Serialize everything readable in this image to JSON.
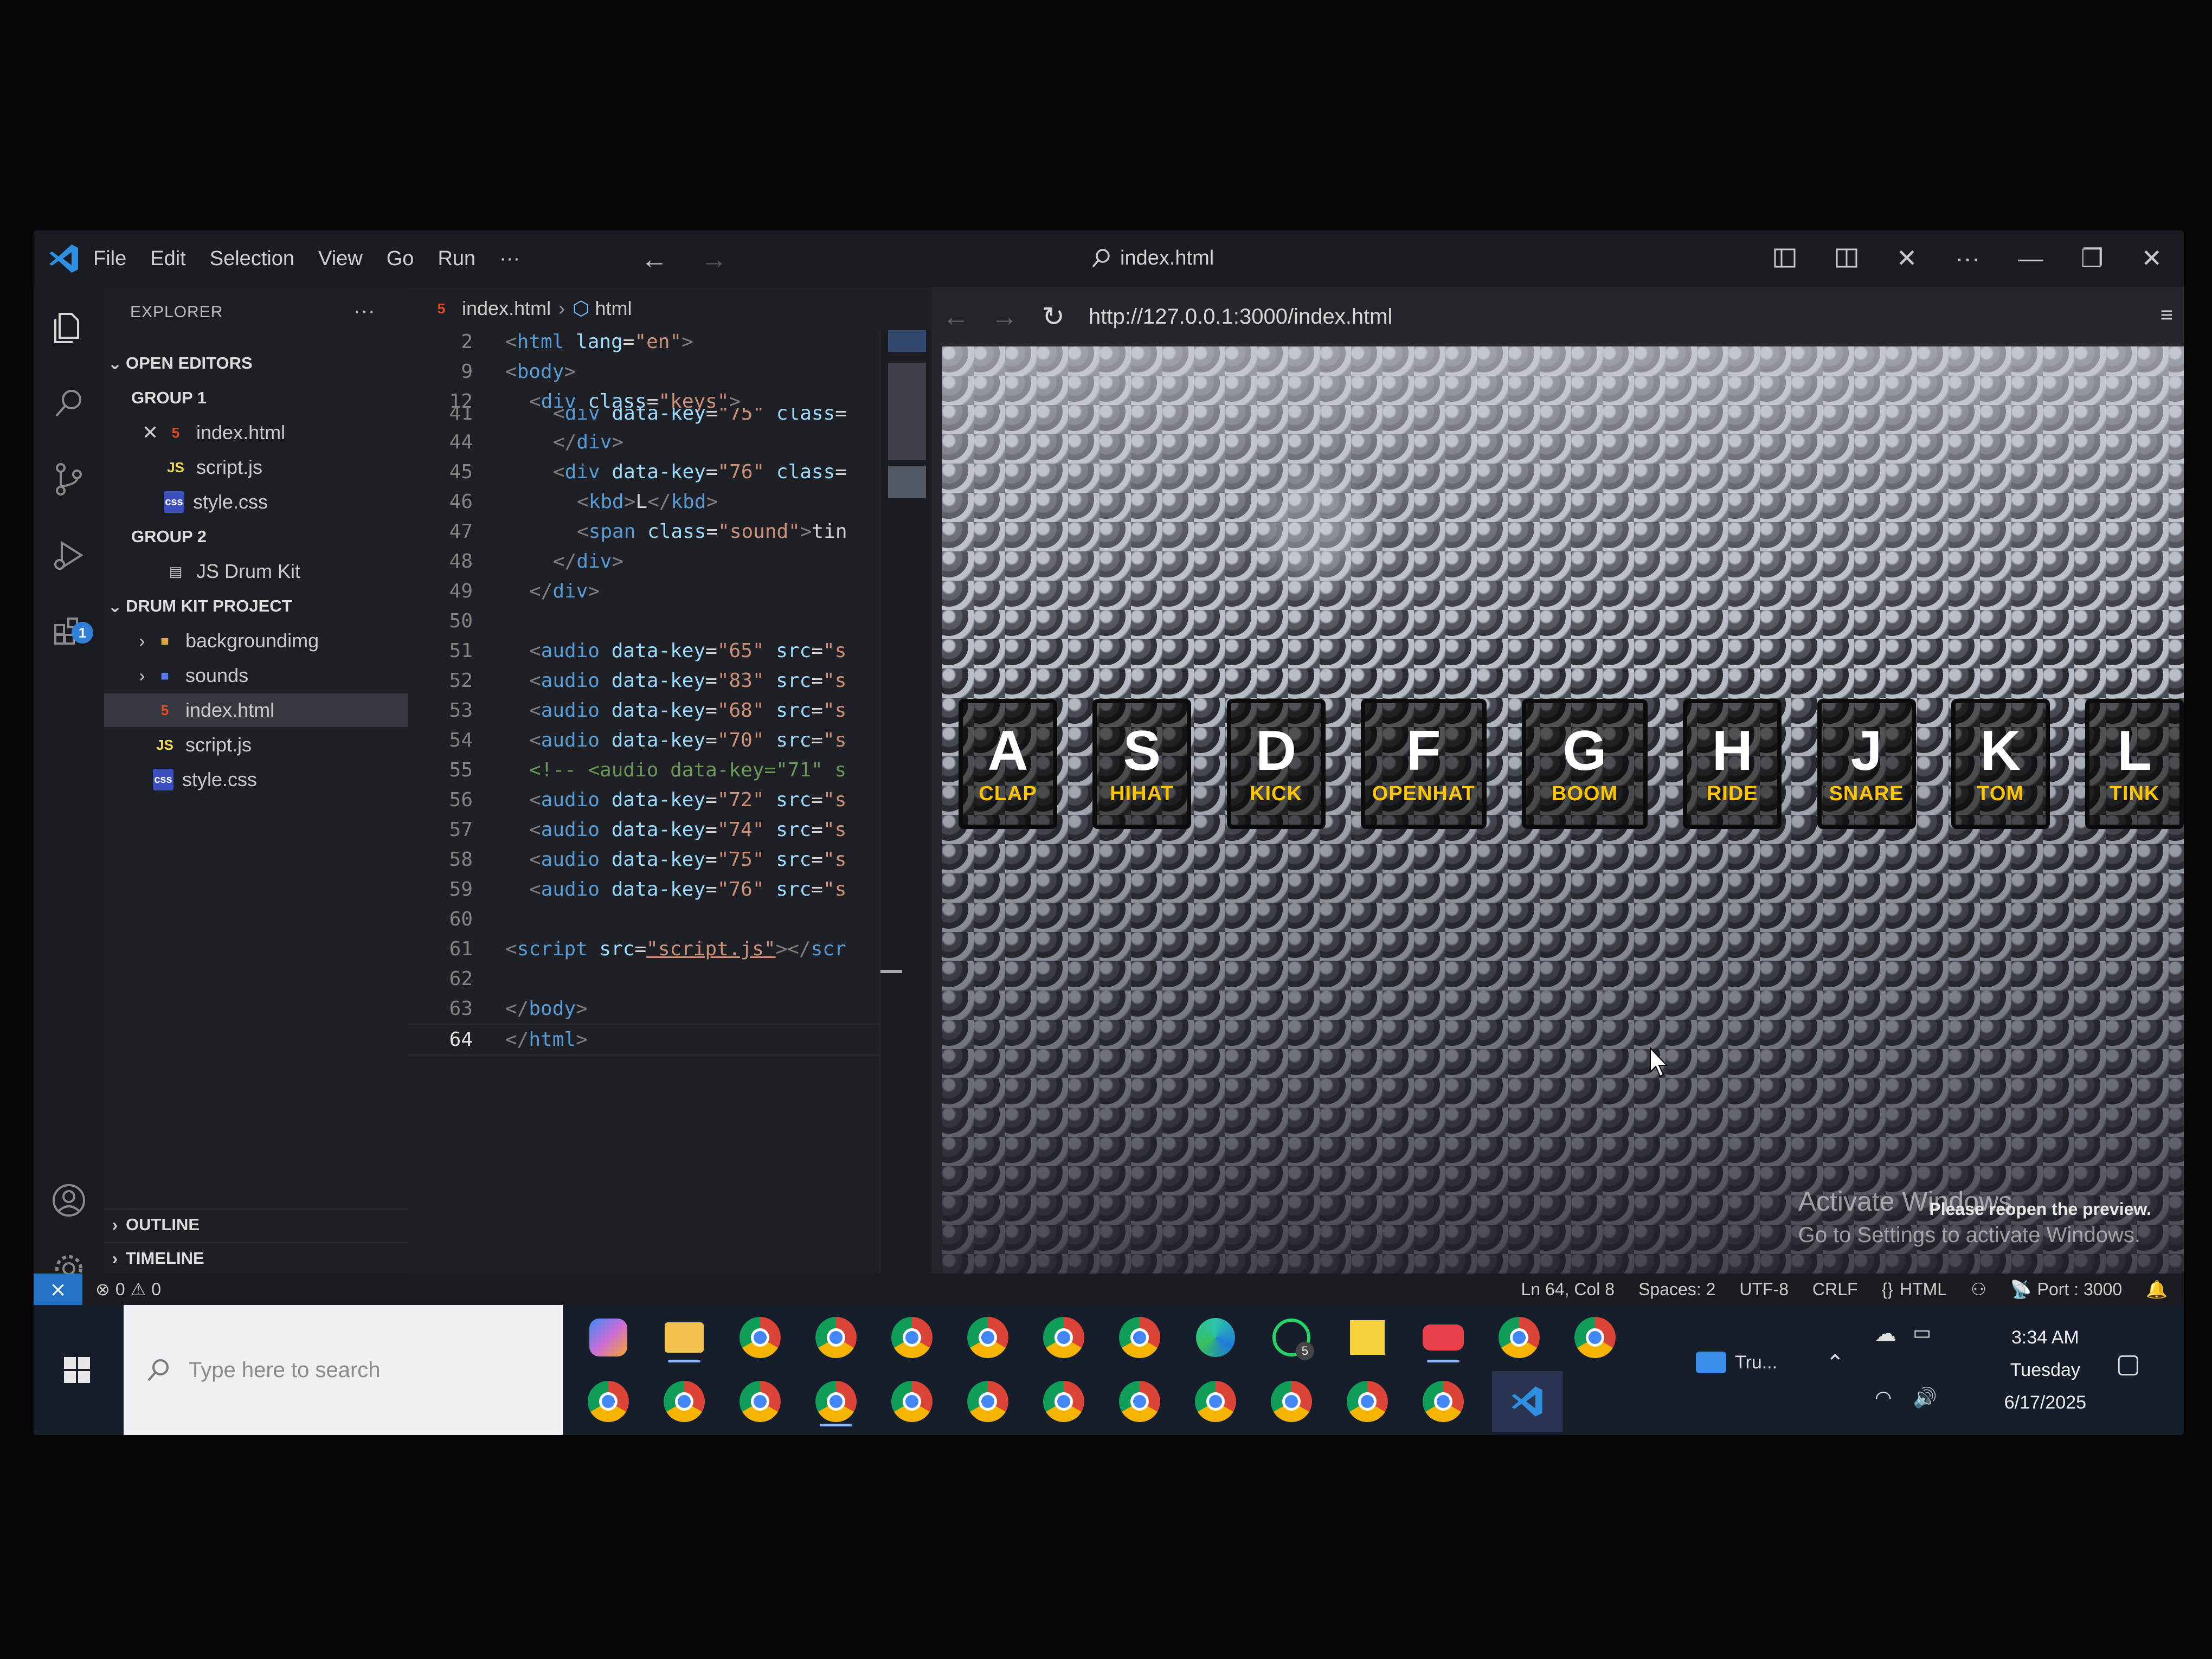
{
  "window": {
    "menu": [
      "File",
      "Edit",
      "Selection",
      "View",
      "Go",
      "Run",
      "···"
    ],
    "search_title": "index.html"
  },
  "sidebar": {
    "title": "EXPLORER",
    "open_editors_label": "OPEN EDITORS",
    "group1_label": "GROUP 1",
    "group1_files": [
      "index.html",
      "script.js",
      "style.css"
    ],
    "group2_label": "GROUP 2",
    "group2_files": [
      "JS Drum Kit"
    ],
    "project_label": "DRUM KIT PROJECT",
    "project_items": [
      "backgroundimg",
      "sounds",
      "index.html",
      "script.js",
      "style.css"
    ],
    "outline_label": "OUTLINE",
    "timeline_label": "TIMELINE",
    "activity_badge": "1"
  },
  "editor": {
    "breadcrumb_file": "index.html",
    "breadcrumb_node": "html",
    "line_numbers": [
      "2",
      "9",
      "12",
      "41",
      "44",
      "45",
      "46",
      "47",
      "48",
      "49",
      "50",
      "51",
      "52",
      "53",
      "54",
      "55",
      "56",
      "57",
      "58",
      "59",
      "60",
      "61",
      "62",
      "63",
      "64"
    ]
  },
  "preview": {
    "url": "http://127.0.0.1:3000/index.html",
    "keys": [
      {
        "key": "A",
        "sound": "CLAP"
      },
      {
        "key": "S",
        "sound": "HIHAT"
      },
      {
        "key": "D",
        "sound": "KICK"
      },
      {
        "key": "F",
        "sound": "OPENHAT"
      },
      {
        "key": "G",
        "sound": "BOOM"
      },
      {
        "key": "H",
        "sound": "RIDE"
      },
      {
        "key": "J",
        "sound": "SNARE"
      },
      {
        "key": "K",
        "sound": "TOM"
      },
      {
        "key": "L",
        "sound": "TINK"
      }
    ],
    "activate_title": "Activate Windows",
    "activate_sub": "Go to Settings to activate Windows.",
    "reopen_notice": "Please reopen the preview."
  },
  "statusbar": {
    "errors": "0",
    "warnings": "0",
    "position": "Ln 64, Col 8",
    "spaces": "Spaces: 2",
    "encoding": "UTF-8",
    "eol": "CRLF",
    "language": "HTML",
    "port": "Port : 3000"
  },
  "taskbar": {
    "search_placeholder": "Type here to search",
    "whatsapp_badge": "5",
    "task_label": "Tru...",
    "time": "3:34 AM",
    "day": "Tuesday",
    "date": "6/17/2025"
  },
  "colors": {
    "accent_blue": "#2472c8",
    "key_label_yellow": "#ffc600"
  }
}
